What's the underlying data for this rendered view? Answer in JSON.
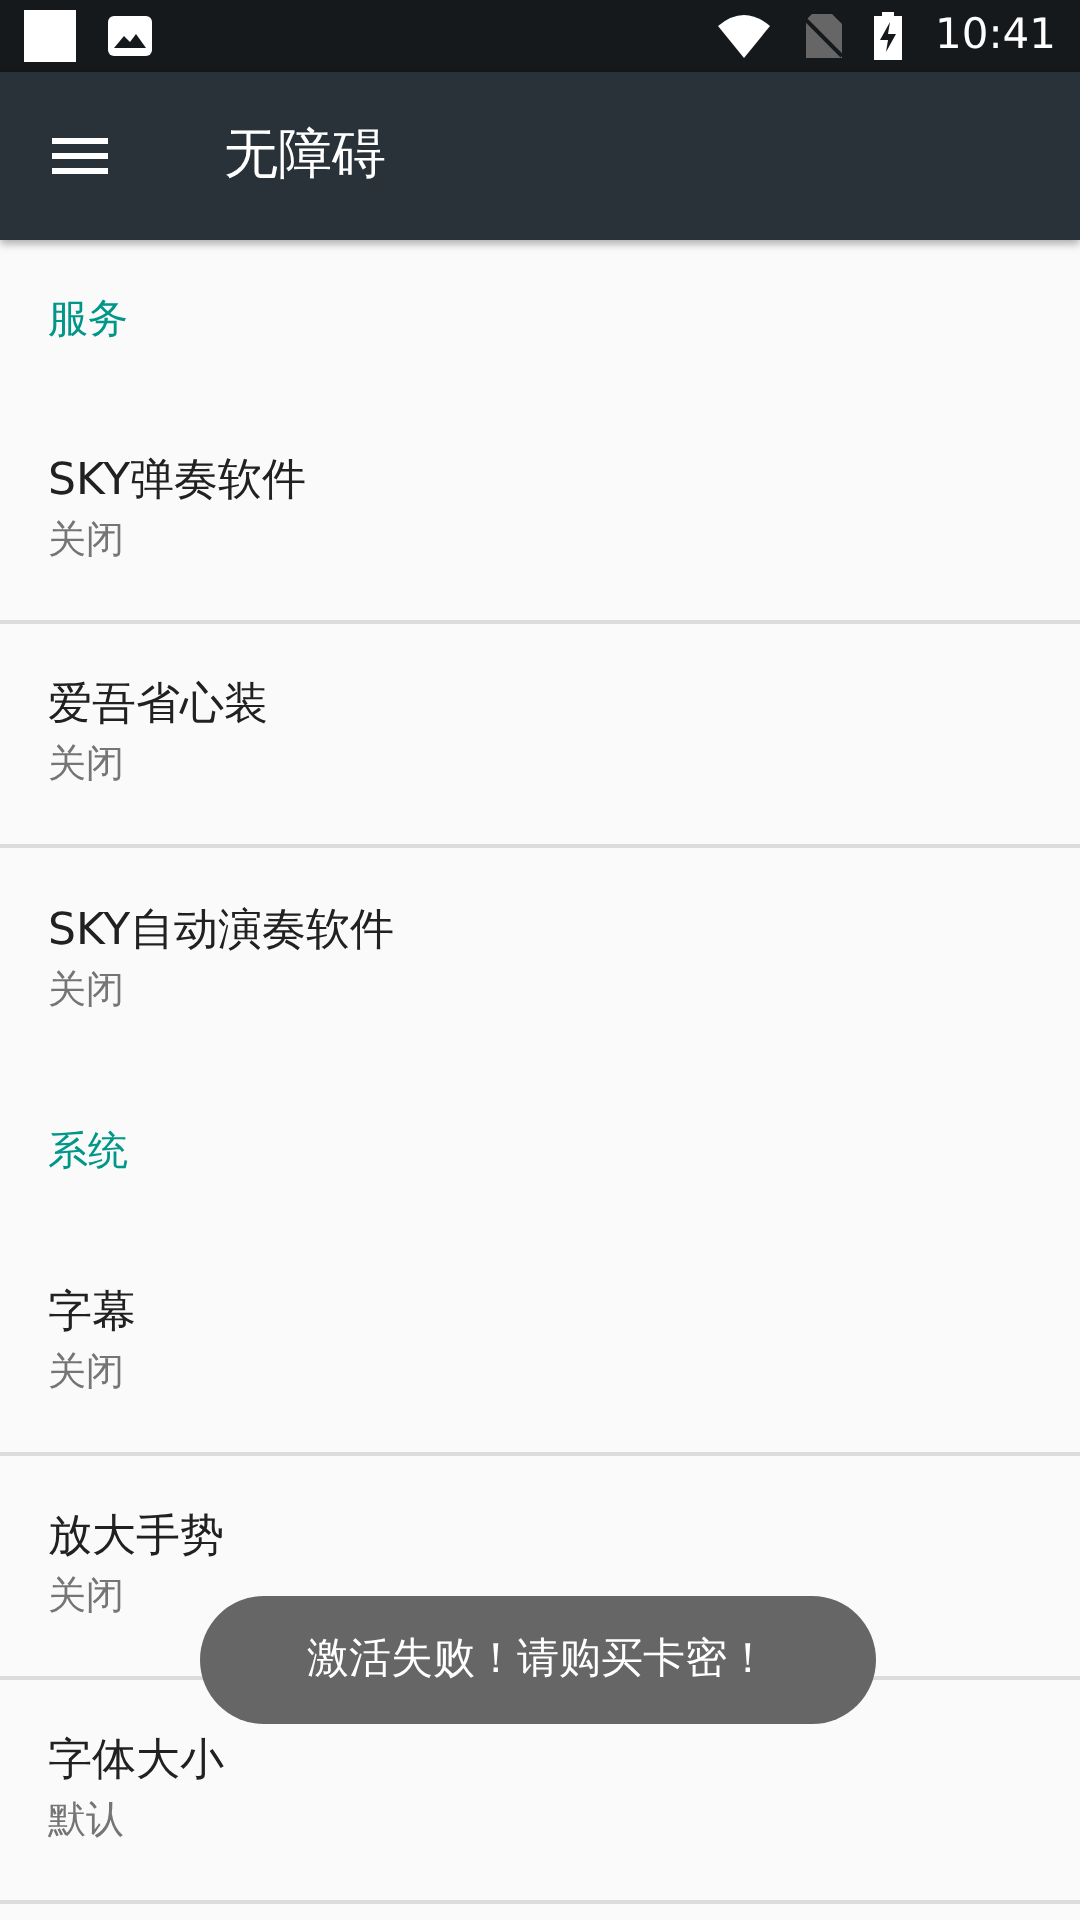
{
  "status_bar": {
    "time": "10:41"
  },
  "app_bar": {
    "title": "无障碍"
  },
  "sections": [
    {
      "title": "服务",
      "items": [
        {
          "title": "SKY弹奏软件",
          "summary": "关闭",
          "divider": true
        },
        {
          "title": "爱吾省心装",
          "summary": "关闭",
          "divider": true
        },
        {
          "title": "SKY自动演奏软件",
          "summary": "关闭",
          "divider": false
        }
      ]
    },
    {
      "title": "系统",
      "items": [
        {
          "title": "字幕",
          "summary": "关闭",
          "divider": true
        },
        {
          "title": "放大手势",
          "summary": "关闭",
          "divider": true
        },
        {
          "title": "字体大小",
          "summary": "默认",
          "divider": true
        }
      ]
    }
  ],
  "toast": {
    "text": "激活失败！请购买卡密！"
  }
}
